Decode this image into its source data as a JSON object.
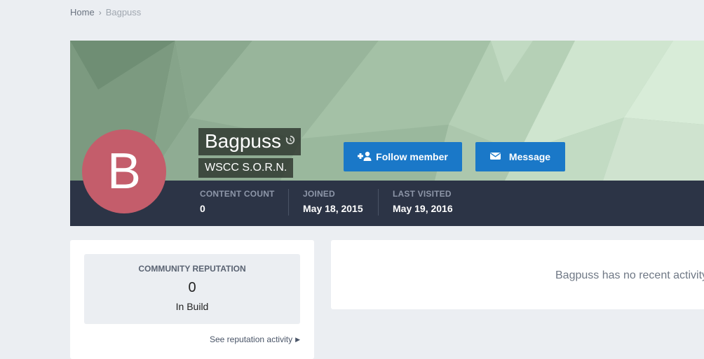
{
  "breadcrumb": {
    "home": "Home",
    "separator": "›",
    "current": "Bagpuss"
  },
  "profile": {
    "avatar_letter": "B",
    "avatar_color": "#c45d6b",
    "name": "Bagpuss",
    "member_title": "WSCC S.O.R.N.",
    "follow_label": "Follow member",
    "message_label": "Message",
    "button_color": "#1a78c8",
    "stats": [
      {
        "label": "CONTENT COUNT",
        "value": "0"
      },
      {
        "label": "JOINED",
        "value": "May 18, 2015"
      },
      {
        "label": "LAST VISITED",
        "value": "May 19, 2016"
      }
    ]
  },
  "reputation": {
    "title": "COMMUNITY REPUTATION",
    "value": "0",
    "label": "In Build",
    "link": "See reputation activity"
  },
  "activity": {
    "empty_message": "Bagpuss has no recent activity to show"
  },
  "icons": {
    "breadcrumb_separator": "chevron-right-icon",
    "history": "history-icon",
    "follow": "user-plus-icon",
    "message": "envelope-icon",
    "link_caret": "caret-right-icon"
  }
}
